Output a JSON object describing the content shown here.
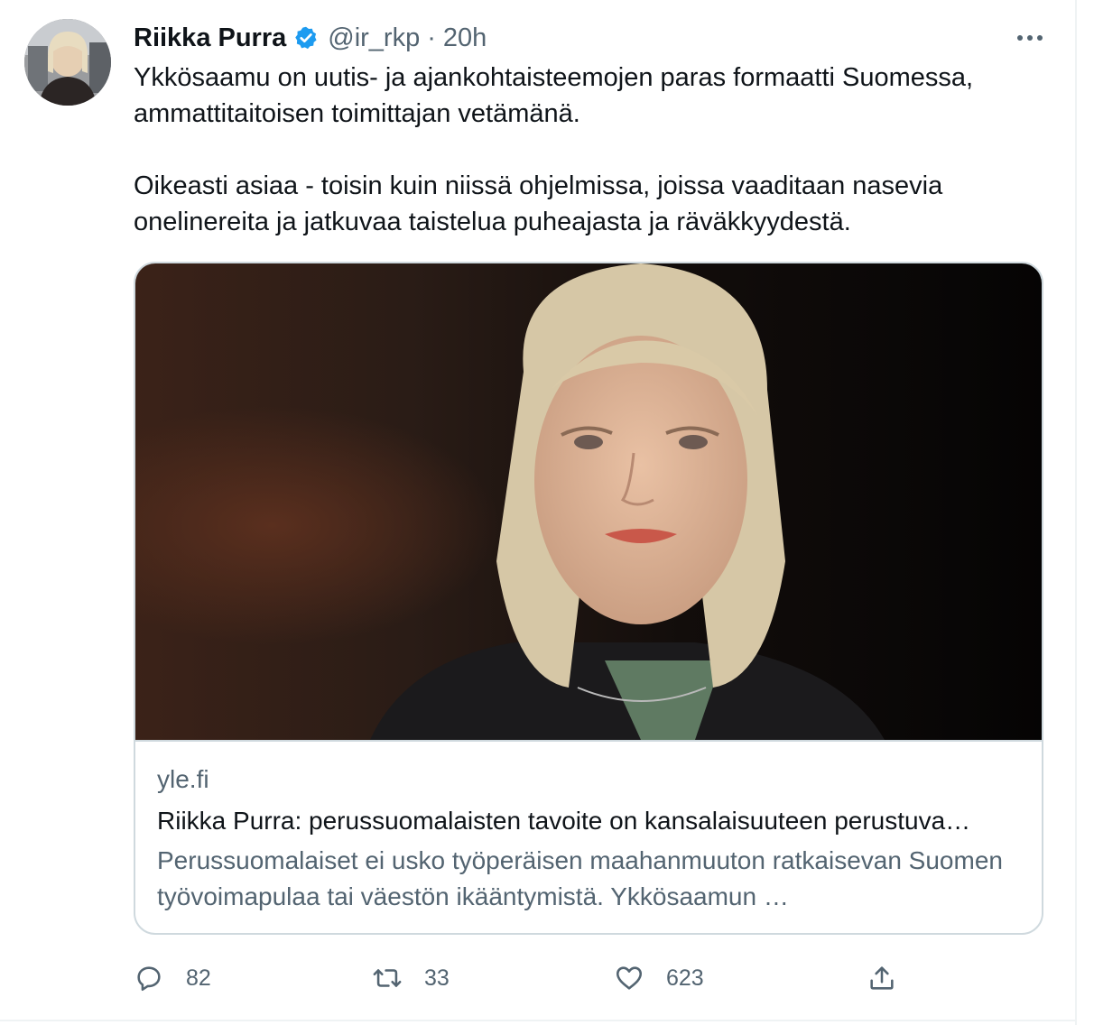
{
  "tweet": {
    "author": {
      "name": "Riikka Purra",
      "handle": "@ir_rkp",
      "verified": true,
      "avatar_icon": "profile-photo"
    },
    "separator": "·",
    "time": "20h",
    "text": [
      "Ykkösaamu on uutis- ja ajankohtaisteemojen paras formaatti Suomessa, ammattitaitoisen toimittajan vetämänä.",
      "Oikeasti asiaa - toisin kuin niissä ohjelmissa, joissa vaaditaan nasevia onelinereita ja jatkuvaa taistelua puheajasta ja räväkkyydestä."
    ],
    "card": {
      "image_icon": "portrait-photo",
      "domain": "yle.fi",
      "title": "Riikka Purra: perussuomalaisten tavoite on kansalaisuuteen perustuva…",
      "description": "Perussuomalaiset ei usko työperäisen maahanmuuton ratkaisevan Suomen työvoimapulaa tai väestön ikääntymistä. Ykkösaamun …"
    },
    "actions": {
      "replies": "82",
      "retweets": "33",
      "likes": "623"
    }
  },
  "colors": {
    "text_primary": "#0f1419",
    "text_secondary": "#536471",
    "verified_blue": "#1d9bf0",
    "border": "#cfd9de"
  }
}
